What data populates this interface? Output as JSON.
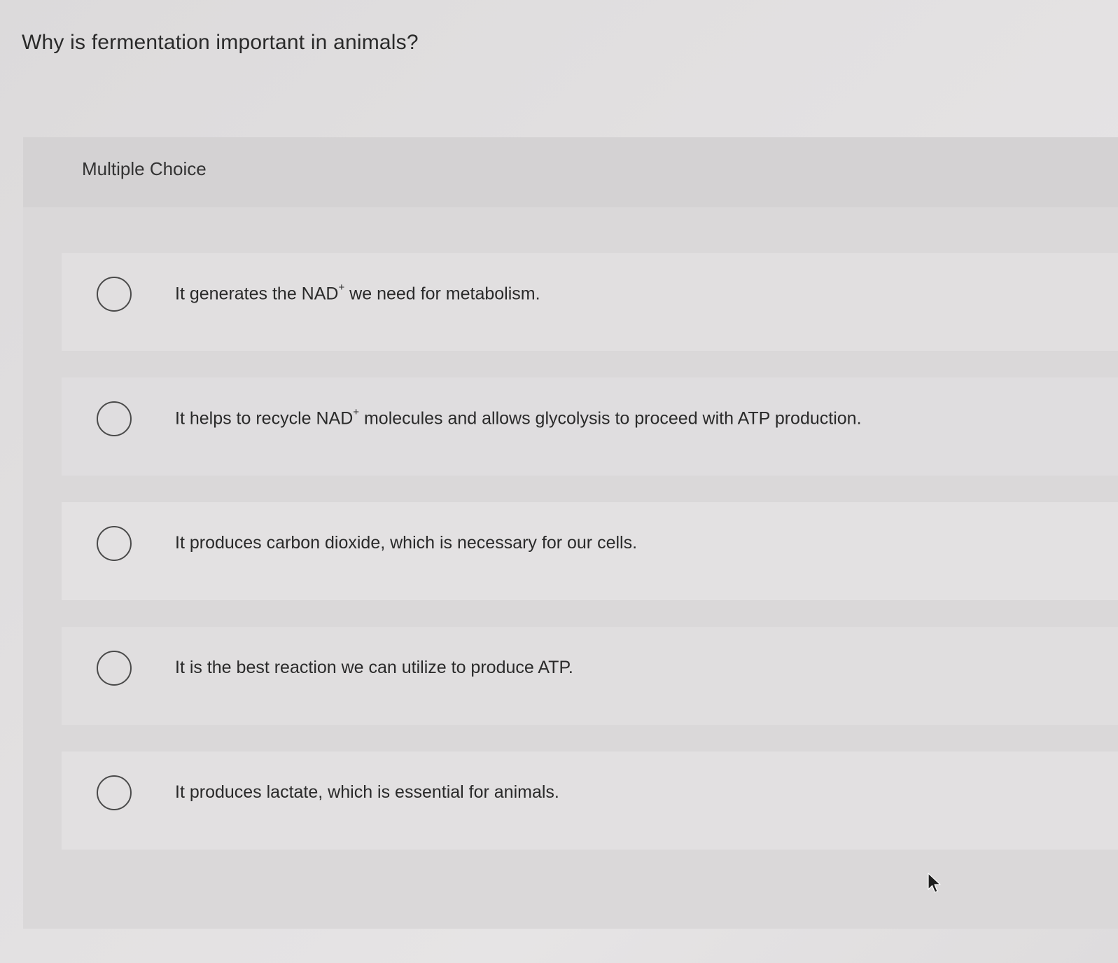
{
  "question": {
    "text": "Why is fermentation important in animals?"
  },
  "panel": {
    "label": "Multiple Choice"
  },
  "options": [
    {
      "before": "It generates the NAD",
      "sup": "+",
      "after": " we need for metabolism."
    },
    {
      "before": "It helps to recycle NAD",
      "sup": "+",
      "after": " molecules and allows glycolysis to proceed with ATP production."
    },
    {
      "before": "It produces carbon dioxide, which is necessary for our cells.",
      "sup": "",
      "after": ""
    },
    {
      "before": "It is the best reaction we can utilize to produce ATP.",
      "sup": "",
      "after": ""
    },
    {
      "before": "It produces lactate, which is essential for animals.",
      "sup": "",
      "after": ""
    }
  ],
  "icons": {
    "option_radio": "radio-unchecked-icon",
    "cursor": "mouse-pointer-icon"
  }
}
